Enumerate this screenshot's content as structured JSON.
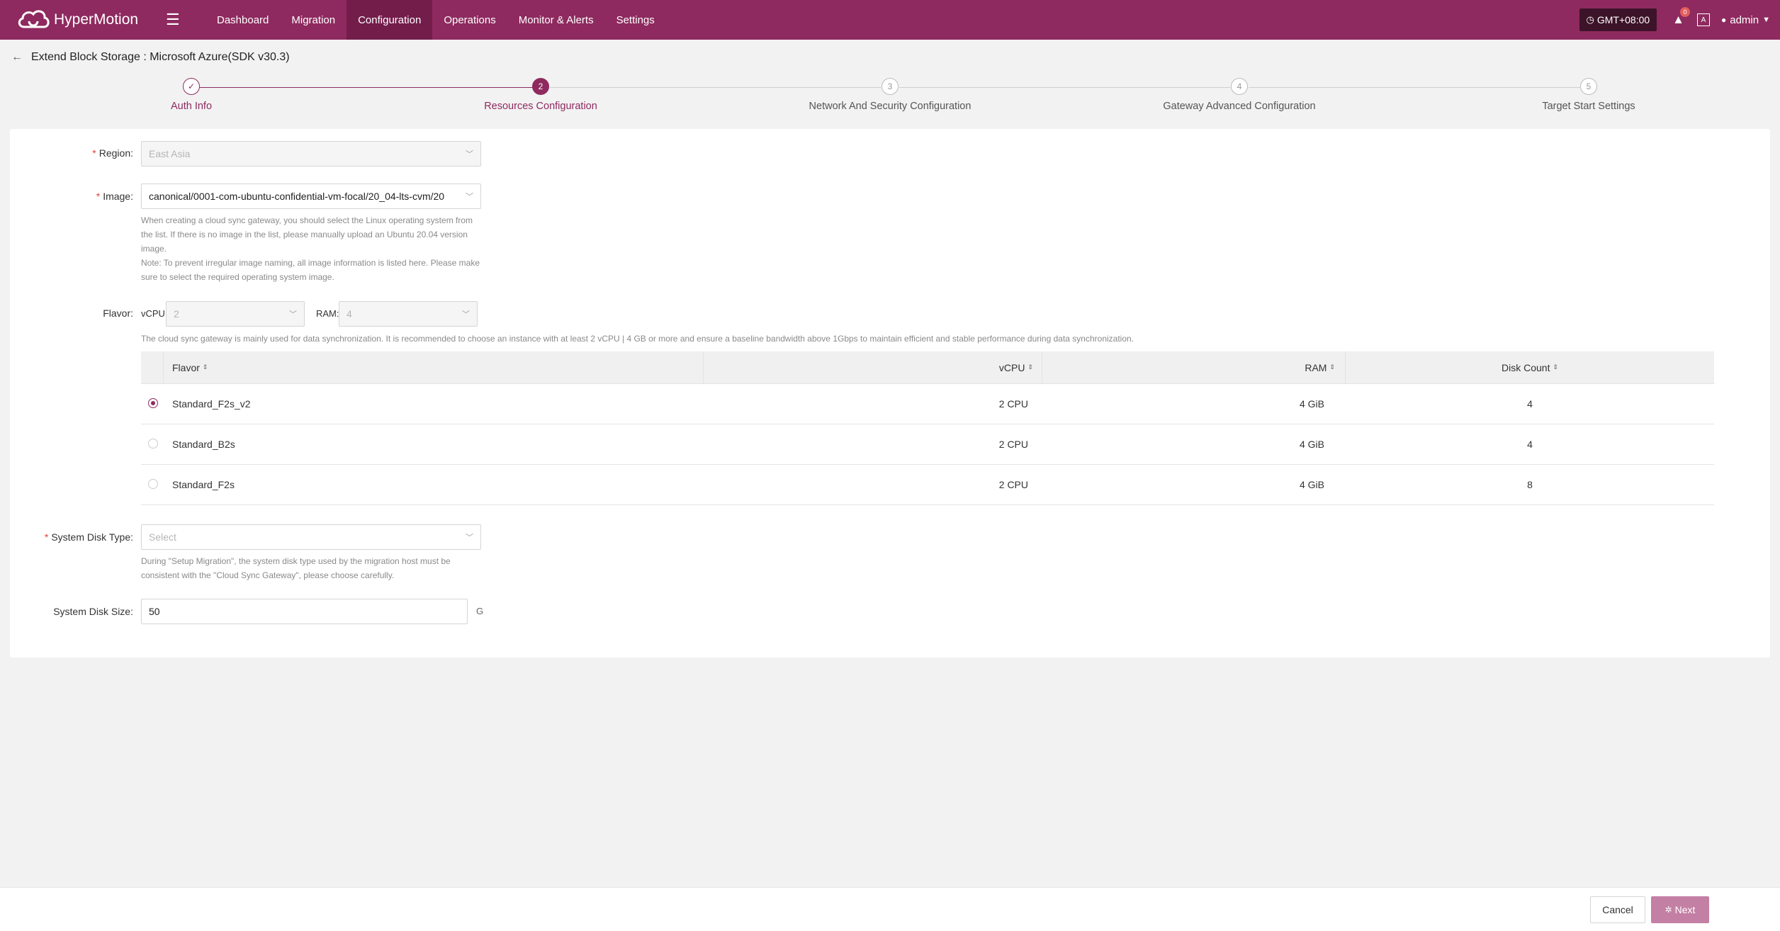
{
  "app": {
    "name": "HyperMotion",
    "nav": [
      "Dashboard",
      "Migration",
      "Configuration",
      "Operations",
      "Monitor & Alerts",
      "Settings"
    ],
    "active_nav": "Configuration",
    "timezone": "GMT+08:00",
    "notification_count": "0",
    "lang_glyph": "A",
    "user": "admin"
  },
  "page": {
    "title": "Extend Block Storage : Microsoft Azure(SDK v30.3)"
  },
  "steps": [
    {
      "num": "✓",
      "label": "Auth Info",
      "state": "done"
    },
    {
      "num": "2",
      "label": "Resources Configuration",
      "state": "active"
    },
    {
      "num": "3",
      "label": "Network And Security Configuration",
      "state": "todo"
    },
    {
      "num": "4",
      "label": "Gateway Advanced Configuration",
      "state": "todo"
    },
    {
      "num": "5",
      "label": "Target Start Settings",
      "state": "todo"
    }
  ],
  "form": {
    "region": {
      "label": "Region:",
      "value": "East Asia"
    },
    "image": {
      "label": "Image:",
      "value": "canonical/0001-com-ubuntu-confidential-vm-focal/20_04-lts-cvm/20",
      "hint_lines": [
        "When creating a cloud sync gateway, you should select the Linux operating system from",
        "the list. If there is no image in the list, please manually upload an Ubuntu 20.04 version",
        "image.",
        "Note: To prevent irregular image naming, all image information is listed here. Please make",
        "sure to select the required operating system image."
      ]
    },
    "flavor": {
      "label": "Flavor:",
      "vcpu_label": "vCPU:",
      "vcpu_value": "2",
      "ram_label": "RAM:",
      "ram_value": "4",
      "hint": "The cloud sync gateway is mainly used for data synchronization. It is recommended to choose an instance with at least 2 vCPU | 4 GB or more and ensure a baseline bandwidth above 1Gbps to maintain efficient and stable performance during data synchronization."
    },
    "table": {
      "columns": [
        "Flavor",
        "vCPU",
        "RAM",
        "Disk Count"
      ],
      "rows": [
        {
          "flavor": "Standard_F2s_v2",
          "vcpu": "2 CPU",
          "ram": "4 GiB",
          "disk": "4",
          "selected": true
        },
        {
          "flavor": "Standard_B2s",
          "vcpu": "2 CPU",
          "ram": "4 GiB",
          "disk": "4",
          "selected": false
        },
        {
          "flavor": "Standard_F2s",
          "vcpu": "2 CPU",
          "ram": "4 GiB",
          "disk": "8",
          "selected": false
        }
      ]
    },
    "system_disk_type": {
      "label": "System Disk Type:",
      "placeholder": "Select",
      "hint_lines": [
        "During \"Setup Migration\", the system disk type used by the migration host must be",
        "consistent with the \"Cloud Sync Gateway\", please choose carefully."
      ]
    },
    "system_disk_size": {
      "label": "System Disk Size:",
      "value": "50",
      "unit": "G"
    }
  },
  "footer": {
    "cancel": "Cancel",
    "next": "Next"
  },
  "colors": {
    "brand": "#8e2a5f",
    "brand_dark": "#731d4b",
    "next_disabled": "#c47fa4"
  }
}
